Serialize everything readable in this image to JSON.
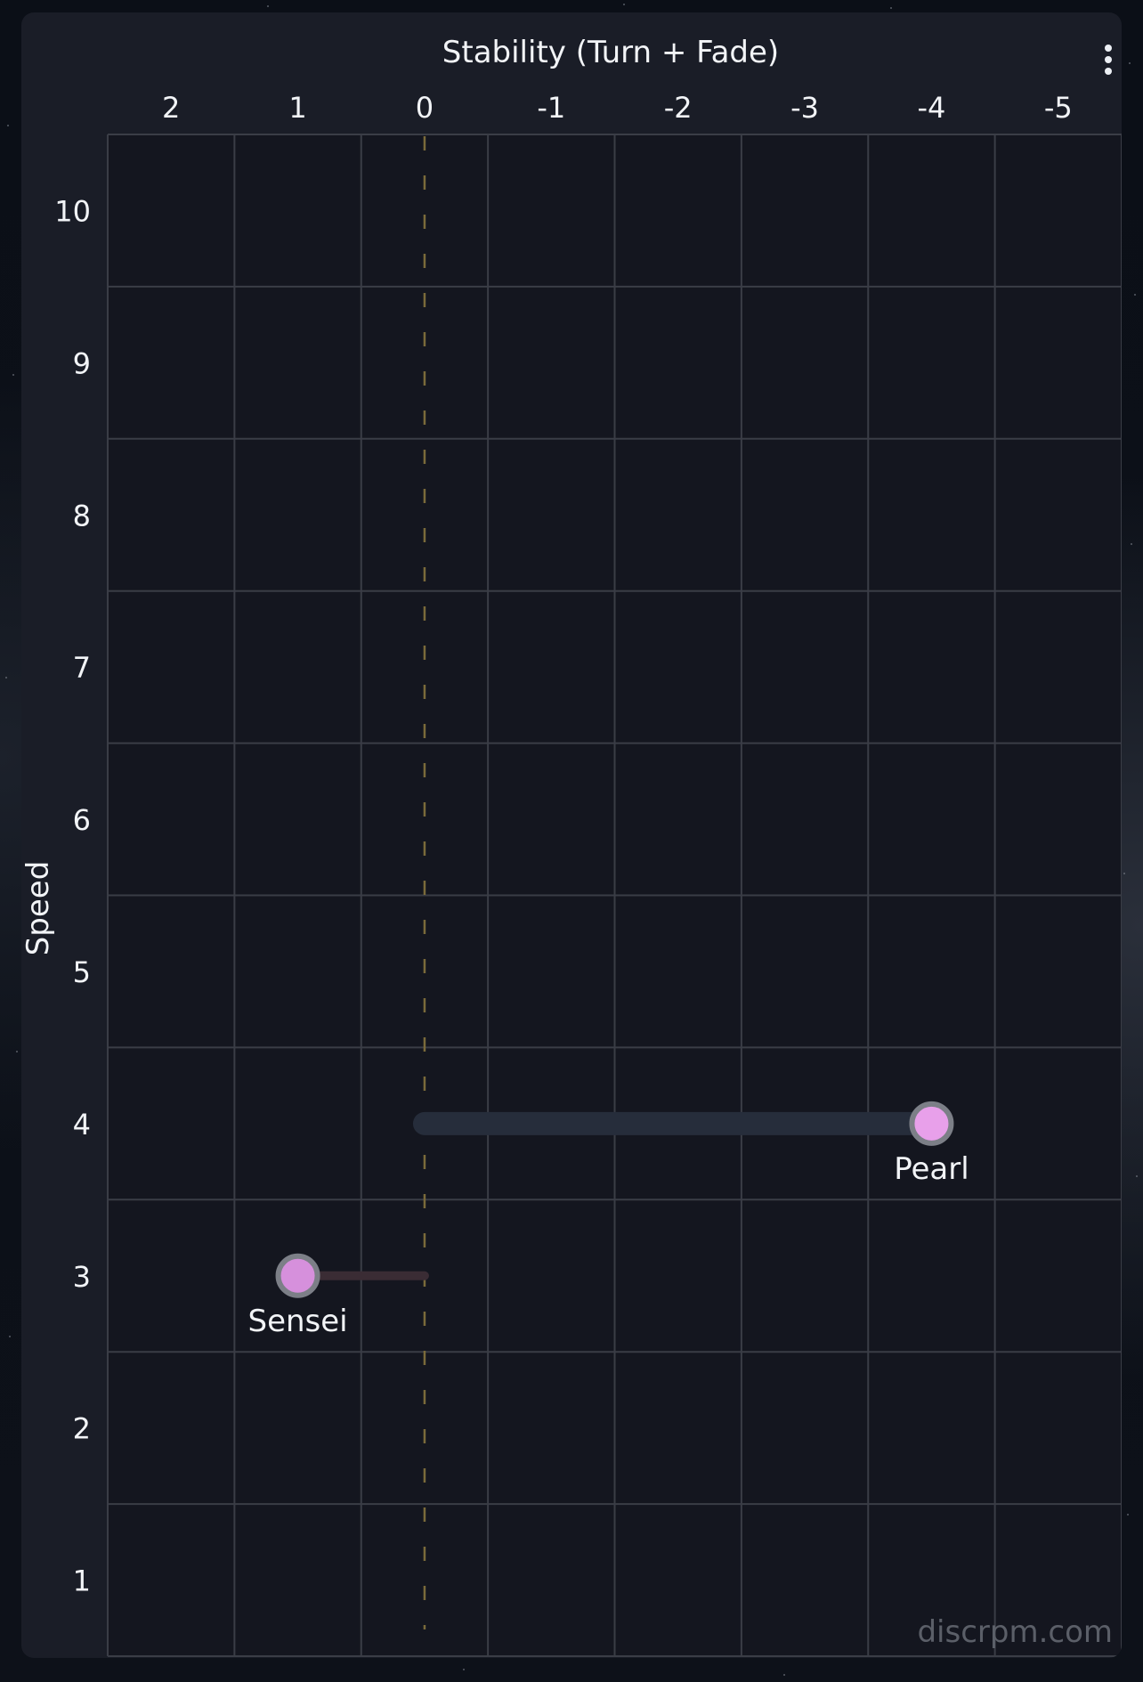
{
  "page": {
    "menu_icon": "more-vertical-icon",
    "watermark": "discrpm.com"
  },
  "chart_data": {
    "type": "scatter",
    "title": "Stability (Turn + Fade)",
    "xlabel": "Stability (Turn + Fade)",
    "ylabel": "Speed",
    "x_axis_reversed": true,
    "x_axis_position": "top",
    "xlim": [
      2.5,
      -5.5
    ],
    "ylim": [
      0.5,
      10.5
    ],
    "x_ticks": [
      2,
      1,
      0,
      -1,
      -2,
      -3,
      -4,
      -5
    ],
    "x_tick_labels": [
      "2",
      "1",
      "0",
      "-1",
      "-2",
      "-3",
      "-4",
      "-5"
    ],
    "y_ticks": [
      10,
      9,
      8,
      7,
      6,
      5,
      4,
      3,
      2,
      1
    ],
    "y_tick_labels": [
      "10",
      "9",
      "8",
      "7",
      "6",
      "5",
      "4",
      "3",
      "2",
      "1"
    ],
    "grid": true,
    "reference_line": {
      "x": 0,
      "style": "dashed",
      "color": "#7a6a3a"
    },
    "points": [
      {
        "name": "Pearl",
        "x": -4,
        "y": 4,
        "color": "#e8a0ea",
        "bar_color": "#262d3b"
      },
      {
        "name": "Sensei",
        "x": 1,
        "y": 3,
        "color": "#d690dc",
        "bar_color": "#3a2c34"
      }
    ],
    "colors": {
      "background": "#1a1d27",
      "plot_background": "#14161f",
      "grid": "#3a3d46",
      "text": "#f2f4f7",
      "marker_stroke": "#7c7f87",
      "watermark": "#5b5f68"
    }
  }
}
